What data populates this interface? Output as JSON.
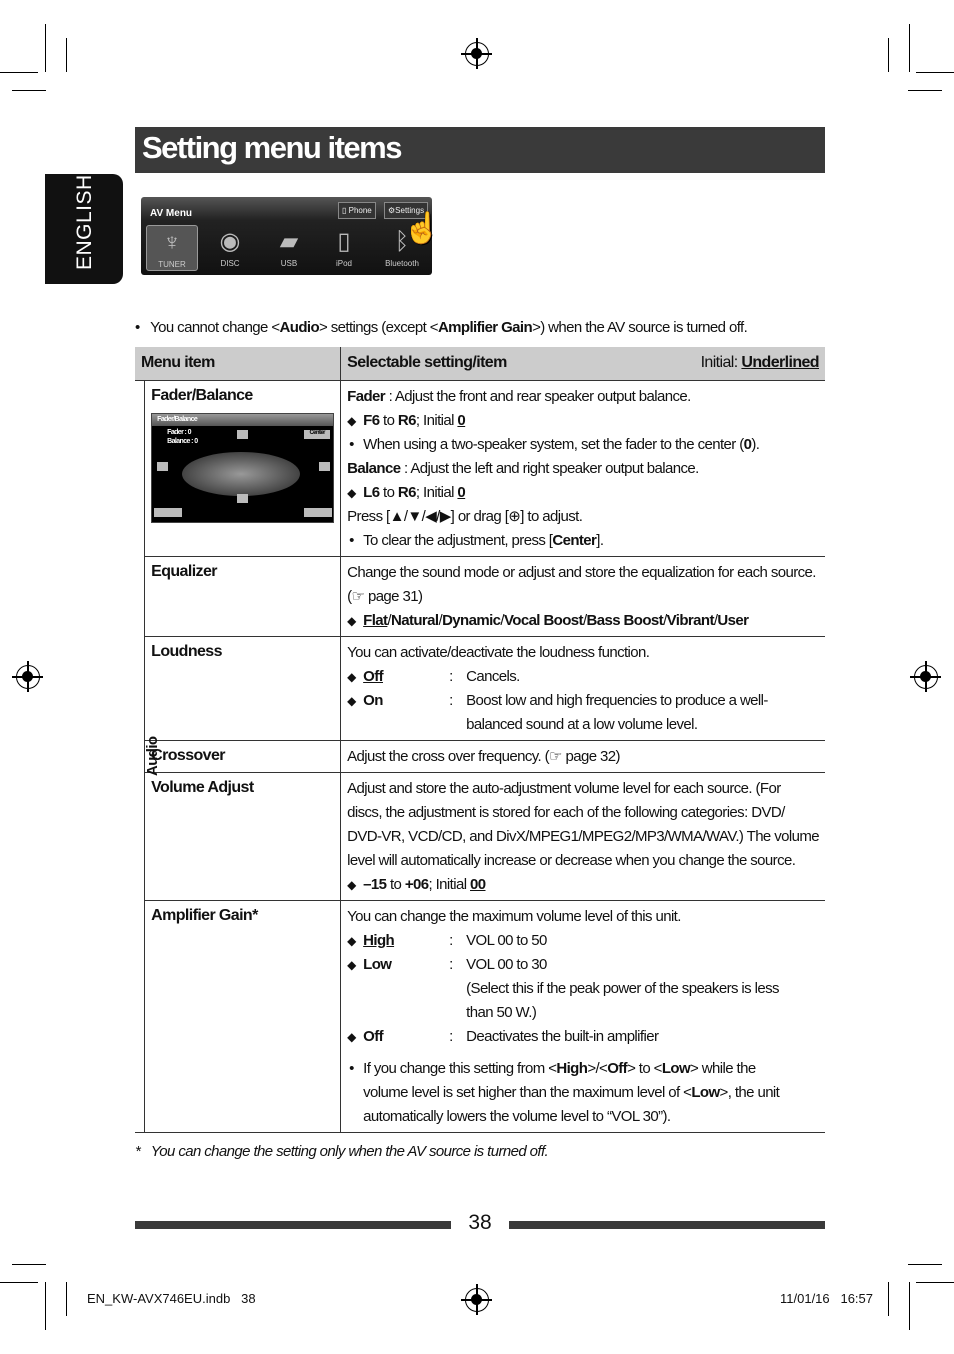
{
  "title": "Setting menu items",
  "language_tab": "ENGLISH",
  "av_menu": {
    "title": "AV Menu",
    "buttons": [
      "Phone",
      "Settings"
    ],
    "sources": [
      {
        "label": "TUNER",
        "icon": "tuner-antenna-icon"
      },
      {
        "label": "DISC",
        "icon": "disc-icon"
      },
      {
        "label": "USB",
        "icon": "usb-icon"
      },
      {
        "label": "iPod",
        "icon": "ipod-icon"
      },
      {
        "label": "Bluetooth",
        "icon": "bluetooth-icon"
      }
    ]
  },
  "note": {
    "bullet": "•",
    "segs": [
      [
        "You cannot change <",
        ""
      ],
      [
        "Audio",
        "b"
      ],
      [
        "> settings (except <",
        ""
      ],
      [
        "Amplifier Gain",
        "b"
      ],
      [
        ">) when the AV source is turned off.",
        ""
      ]
    ]
  },
  "table": {
    "col_menu_item": "Menu item",
    "col_setting": "Selectable setting/item",
    "initial_label": "Initial: ",
    "initial_value": "Underlined",
    "group": "Audio",
    "rows": [
      {
        "item": "Fader/Balance",
        "screen": {
          "title": "Fader/Balance",
          "fader": "Fader : 0",
          "balance": "Balance : 0",
          "center": "Center"
        },
        "lines": [
          {
            "type": "text",
            "segs": [
              [
                "Fader",
                "b"
              ],
              [
                " : Adjust the front and rear speaker output balance.",
                ""
              ]
            ]
          },
          {
            "type": "diamond",
            "segs": [
              [
                "F6",
                "b"
              ],
              [
                " to ",
                ""
              ],
              [
                "R6",
                "b"
              ],
              [
                "; Initial ",
                ""
              ],
              [
                "0",
                "bu"
              ]
            ]
          },
          {
            "type": "bullet",
            "segs": [
              [
                "When using a two-speaker system, set the fader to the center (",
                ""
              ],
              [
                "0",
                "b"
              ],
              [
                ").",
                ""
              ]
            ]
          },
          {
            "type": "text",
            "segs": [
              [
                "Balance",
                "b"
              ],
              [
                " : Adjust the left and right speaker output balance.",
                ""
              ]
            ]
          },
          {
            "type": "diamond",
            "segs": [
              [
                "L6",
                "b"
              ],
              [
                " to ",
                ""
              ],
              [
                "R6",
                "b"
              ],
              [
                "; Initial ",
                ""
              ],
              [
                "0",
                "bu"
              ]
            ]
          },
          {
            "type": "text",
            "segs": [
              [
                "Press [▲/▼/◀/▶] or drag [⊕] to adjust.",
                ""
              ]
            ]
          },
          {
            "type": "bullet",
            "segs": [
              [
                "To clear the adjustment, press [",
                ""
              ],
              [
                "Center",
                "b"
              ],
              [
                "].",
                ""
              ]
            ]
          }
        ]
      },
      {
        "item": "Equalizer",
        "lines": [
          {
            "type": "text",
            "segs": [
              [
                "Change the sound mode or adjust and store the equalization for each source.",
                ""
              ]
            ]
          },
          {
            "type": "text",
            "segs": [
              [
                "(☞ page 31)",
                ""
              ]
            ]
          },
          {
            "type": "diamond",
            "segs": [
              [
                "Flat",
                "bu"
              ],
              [
                "/",
                ""
              ],
              [
                "Natural",
                "b"
              ],
              [
                "/",
                ""
              ],
              [
                "Dynamic",
                "b"
              ],
              [
                "/",
                ""
              ],
              [
                "Vocal Boost",
                "b"
              ],
              [
                "/",
                ""
              ],
              [
                "Bass Boost",
                "b"
              ],
              [
                "/",
                ""
              ],
              [
                "Vibrant",
                "b"
              ],
              [
                "/",
                ""
              ],
              [
                "User",
                "b"
              ]
            ]
          }
        ]
      },
      {
        "item": "Loudness",
        "lines": [
          {
            "type": "text",
            "segs": [
              [
                "You can activate/deactivate the loudness function.",
                ""
              ]
            ]
          },
          {
            "type": "opt",
            "label": [
              "Off",
              "bu"
            ],
            "colon": ":",
            "segs": [
              [
                "Cancels.",
                ""
              ]
            ]
          },
          {
            "type": "opt",
            "label": [
              "On",
              "b"
            ],
            "colon": ":",
            "segs": [
              [
                "Boost low and high frequencies to produce a well-",
                ""
              ]
            ]
          },
          {
            "type": "cont",
            "segs": [
              [
                "balanced sound at a low volume level.",
                ""
              ]
            ]
          }
        ]
      },
      {
        "item": "Crossover",
        "lines": [
          {
            "type": "text",
            "segs": [
              [
                "Adjust the cross over frequency. (☞ page 32)",
                ""
              ]
            ]
          }
        ]
      },
      {
        "item": "Volume Adjust",
        "lines": [
          {
            "type": "text",
            "segs": [
              [
                "Adjust and store the auto-adjustment volume level for each source. (For",
                ""
              ]
            ]
          },
          {
            "type": "text",
            "segs": [
              [
                "discs, the adjustment is stored for each of the following categories: DVD/",
                ""
              ]
            ]
          },
          {
            "type": "text",
            "segs": [
              [
                "DVD-VR, VCD/CD, and DivX/MPEG1/MPEG2/MP3/WMA/WAV.) The volume",
                ""
              ]
            ]
          },
          {
            "type": "text",
            "segs": [
              [
                "level will automatically increase or decrease when you change the source.",
                ""
              ]
            ]
          },
          {
            "type": "diamond",
            "segs": [
              [
                "–15",
                "b"
              ],
              [
                " to ",
                ""
              ],
              [
                "+06",
                "b"
              ],
              [
                "; Initial ",
                ""
              ],
              [
                "00",
                "bu"
              ]
            ]
          }
        ]
      },
      {
        "item": "Amplifier Gain*",
        "lines": [
          {
            "type": "text",
            "segs": [
              [
                "You can change the maximum volume level of this unit.",
                ""
              ]
            ]
          },
          {
            "type": "opt",
            "label": [
              "High",
              "bu"
            ],
            "colon": ":",
            "segs": [
              [
                "VOL 00 to 50",
                ""
              ]
            ]
          },
          {
            "type": "opt",
            "label": [
              "Low",
              "b"
            ],
            "colon": ":",
            "segs": [
              [
                "VOL 00 to 30",
                ""
              ]
            ]
          },
          {
            "type": "cont",
            "segs": [
              [
                "(Select this if the peak power of the speakers is less",
                ""
              ]
            ]
          },
          {
            "type": "cont",
            "segs": [
              [
                "than 50 W.)",
                ""
              ]
            ]
          },
          {
            "type": "opt",
            "label": [
              "Off",
              "b"
            ],
            "colon": ":",
            "segs": [
              [
                "Deactivates the built-in amplifier",
                ""
              ]
            ]
          },
          {
            "type": "gap",
            "segs": []
          },
          {
            "type": "bullet",
            "segs": [
              [
                "If you change this setting from <",
                ""
              ],
              [
                "High",
                "b"
              ],
              [
                ">/<",
                ""
              ],
              [
                "Off",
                "b"
              ],
              [
                "> to <",
                ""
              ],
              [
                "Low",
                "b"
              ],
              [
                "> while the",
                ""
              ]
            ]
          },
          {
            "type": "bullet2",
            "segs": [
              [
                "volume level is set higher than the maximum level of <",
                ""
              ],
              [
                "Low",
                "b"
              ],
              [
                ">, the unit",
                ""
              ]
            ]
          },
          {
            "type": "bullet2",
            "segs": [
              [
                "automatically lowers the volume level to “VOL 30”).",
                ""
              ]
            ]
          }
        ]
      }
    ]
  },
  "footnote": {
    "mark": "*",
    "text": "You can change the setting only when the AV source is turned off."
  },
  "page_number": "38",
  "slug_left": "EN_KW-AVX746EU.indb   38",
  "slug_right": "11/01/16   16:57"
}
